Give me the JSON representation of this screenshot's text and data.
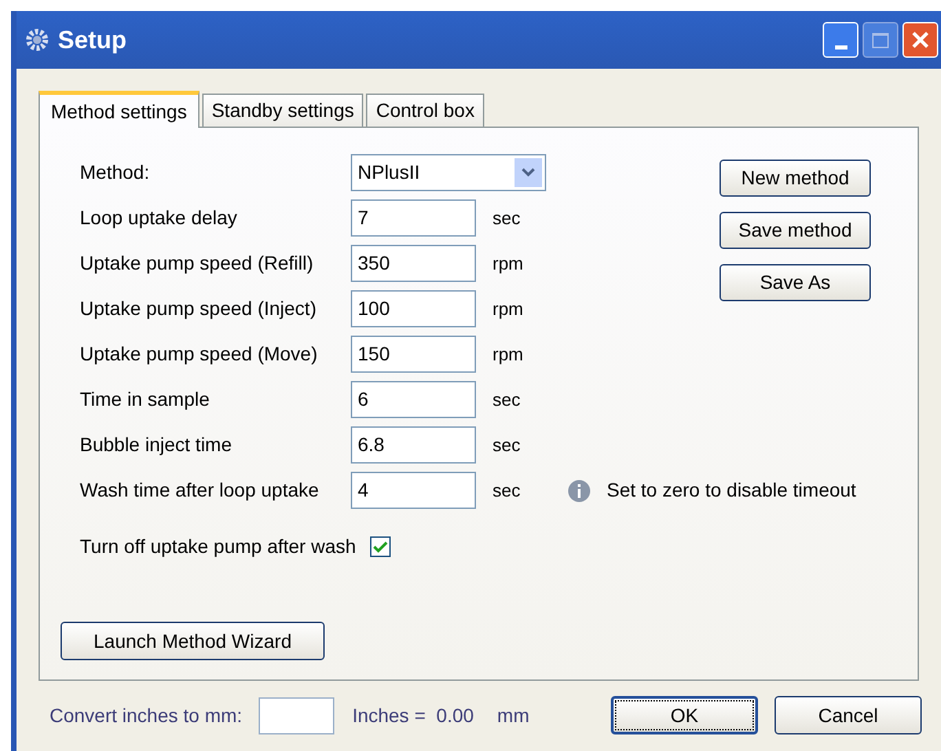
{
  "window": {
    "title": "Setup"
  },
  "tabs": [
    {
      "label": "Method settings",
      "selected": true
    },
    {
      "label": "Standby settings",
      "selected": false
    },
    {
      "label": "Control box",
      "selected": false
    }
  ],
  "fields": [
    {
      "kind": "dropdown",
      "label": "Method:",
      "value": "NPlusII"
    },
    {
      "kind": "text",
      "label": "Loop uptake delay",
      "value": "7",
      "unit": "sec"
    },
    {
      "kind": "text",
      "label": "Uptake pump speed (Refill)",
      "value": "350",
      "unit": "rpm"
    },
    {
      "kind": "text",
      "label": "Uptake pump speed (Inject)",
      "value": "100",
      "unit": "rpm"
    },
    {
      "kind": "text",
      "label": "Uptake pump speed (Move)",
      "value": "150",
      "unit": "rpm"
    },
    {
      "kind": "text",
      "label": "Time in sample",
      "value": "6",
      "unit": "sec"
    },
    {
      "kind": "text",
      "label": "Bubble inject time",
      "value": "6.8",
      "unit": "sec"
    },
    {
      "kind": "text",
      "label": "Wash time after loop uptake",
      "value": "4",
      "unit": "sec",
      "hint": "Set to zero to disable timeout"
    }
  ],
  "checkbox": {
    "label": "Turn off uptake pump after wash",
    "checked": true
  },
  "method_buttons": [
    "New method",
    "Save method",
    "Save As"
  ],
  "wizard_button": "Launch Method Wizard",
  "converter": {
    "label": "Convert inches to mm:",
    "result": "Inches =  0.00",
    "unit": "mm"
  },
  "buttons": [
    {
      "label": "OK",
      "selected": true
    },
    {
      "label": "Cancel",
      "selected": false
    }
  ]
}
